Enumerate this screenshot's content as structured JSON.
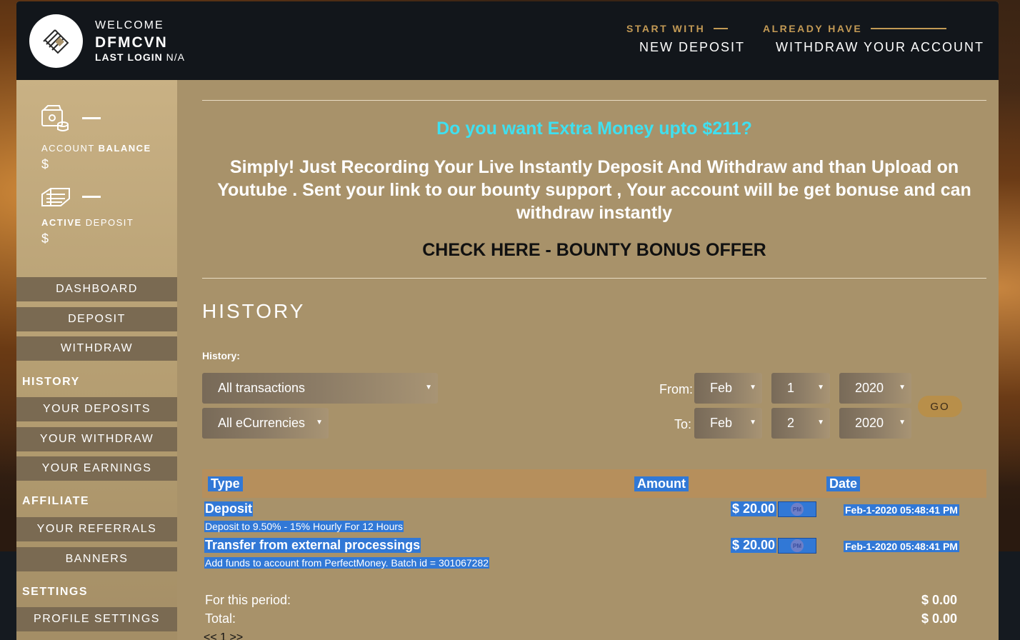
{
  "header": {
    "welcome": "WELCOME",
    "username": "DFMCVN",
    "last_login_label": "LAST LOGIN",
    "last_login_value": "N/A",
    "start_with_label": "START WITH",
    "start_with_link": "NEW DEPOSIT",
    "already_have_label": "ALREADY HAVE",
    "already_have_link": "WITHDRAW YOUR ACCOUNT",
    "logo_icon": "logo-diamond-icon"
  },
  "sidebar": {
    "balance_label_1": "ACCOUNT",
    "balance_label_2": "BALANCE",
    "balance_value": "$",
    "active_label_1": "ACTIVE",
    "active_label_2": "DEPOSIT",
    "active_value": "$",
    "nav": {
      "dashboard": "DASHBOARD",
      "deposit": "DEPOSIT",
      "withdraw": "WITHDRAW",
      "history_head": "HISTORY",
      "your_deposits": "YOUR DEPOSITS",
      "your_withdraw": "YOUR WITHDRAW",
      "your_earnings": "YOUR EARNINGS",
      "affiliate_head": "AFFILIATE",
      "your_referrals": "YOUR REFERRALS",
      "banners": "BANNERS",
      "settings_head": "SETTINGS",
      "profile_settings": "PROFILE SETTINGS"
    }
  },
  "promo": {
    "title": "Do you want Extra Money upto $211?",
    "text": "Simply! Just Recording Your Live Instantly Deposit And Withdraw and than Upload on Youtube . Sent your link to our bounty support , Your account will be get bonuse and can withdraw instantly",
    "link": "CHECK HERE - BOUNTY BONUS OFFER"
  },
  "history": {
    "title": "HISTORY",
    "filter_label": "History:",
    "type_select": "All transactions",
    "currency_select": "All eCurrencies",
    "from_label": "From:",
    "to_label": "To:",
    "from": {
      "month": "Feb",
      "day": "1",
      "year": "2020"
    },
    "to": {
      "month": "Feb",
      "day": "2",
      "year": "2020"
    },
    "go_label": "GO",
    "columns": {
      "type": "Type",
      "amount": "Amount",
      "date": "Date"
    },
    "rows": [
      {
        "type": "Deposit",
        "amount": "$ 20.00",
        "processor_badge": "PM",
        "date": "Feb-1-2020 05:48:41 PM",
        "description": "Deposit to 9.50% - 15% Hourly For 12 Hours"
      },
      {
        "type": "Transfer from external processings",
        "amount": "$ 20.00",
        "processor_badge": "PM",
        "date": "Feb-1-2020 05:48:41 PM",
        "description": "Add funds to account from PerfectMoney. Batch id = 301067282"
      }
    ],
    "period_label": "For this period:",
    "period_value": "$ 0.00",
    "total_label": "Total:",
    "total_value": "$ 0.00",
    "pager": "<< 1 >>"
  }
}
